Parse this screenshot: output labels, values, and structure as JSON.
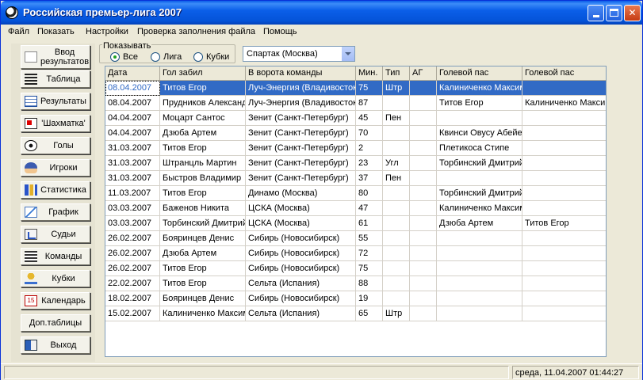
{
  "window": {
    "title": "Российская премьер-лига 2007",
    "min_label": "_",
    "close_label": "✕"
  },
  "menu": [
    "Файл",
    "Показать",
    "Настройки",
    "Проверка заполнения файла",
    "Помощь"
  ],
  "sidebar": [
    {
      "label": "Ввод результатов",
      "icon": "input-icon"
    },
    {
      "label": "Таблица",
      "icon": "list-icon"
    },
    {
      "label": "Результаты",
      "icon": "table-icon"
    },
    {
      "label": "'Шахматка'",
      "icon": "grid-icon"
    },
    {
      "label": "Голы",
      "icon": "ball-icon"
    },
    {
      "label": "Игроки",
      "icon": "player-icon"
    },
    {
      "label": "Статистика",
      "icon": "statistics-icon"
    },
    {
      "label": "График",
      "icon": "chart-icon"
    },
    {
      "label": "Судьи",
      "icon": "referee-icon"
    },
    {
      "label": "Команды",
      "icon": "teams-icon"
    },
    {
      "label": "Кубки",
      "icon": "cup-icon"
    },
    {
      "label": "Календарь",
      "icon": "calendar-icon"
    },
    {
      "label": "Доп.таблицы",
      "icon": ""
    },
    {
      "label": "Выход",
      "icon": "exit-icon"
    }
  ],
  "calendar_icon_text": "15",
  "filter": {
    "legend": "Показывать",
    "options": [
      "Все",
      "Лига",
      "Кубки"
    ],
    "selected": "Все",
    "team": "Спартак (Москва)"
  },
  "grid": {
    "columns": [
      "Дата",
      "Гол забил",
      "В ворота команды",
      "Мин.",
      "Тип",
      "АГ",
      "Голевой пас",
      "Голевой пас"
    ],
    "rows": [
      [
        "08.04.2007",
        "Титов Егор",
        "Луч-Энергия (Владивосток)",
        "75",
        "Штр",
        "",
        "Калиниченко Максим",
        ""
      ],
      [
        "08.04.2007",
        "Прудников Александр",
        "Луч-Энергия (Владивосток)",
        "87",
        "",
        "",
        "Титов Егор",
        "Калиниченко Максим"
      ],
      [
        "04.04.2007",
        "Моцарт Сантос",
        "Зенит (Санкт-Петербург)",
        "45",
        "Пен",
        "",
        "",
        ""
      ],
      [
        "04.04.2007",
        "Дзюба Артем",
        "Зенит (Санкт-Петербург)",
        "70",
        "",
        "",
        "Квинси Овусу Абейе",
        ""
      ],
      [
        "31.03.2007",
        "Титов Егор",
        "Зенит (Санкт-Петербург)",
        "2",
        "",
        "",
        "Плетикоса Стипе",
        ""
      ],
      [
        "31.03.2007",
        "Штранцль Мартин",
        "Зенит (Санкт-Петербург)",
        "23",
        "Угл",
        "",
        "Торбинский Дмитрий",
        ""
      ],
      [
        "31.03.2007",
        "Быстров Владимир",
        "Зенит (Санкт-Петербург)",
        "37",
        "Пен",
        "",
        "",
        ""
      ],
      [
        "11.03.2007",
        "Титов Егор",
        "Динамо (Москва)",
        "80",
        "",
        "",
        "Торбинский Дмитрий",
        ""
      ],
      [
        "03.03.2007",
        "Баженов Никита",
        "ЦСКА (Москва)",
        "47",
        "",
        "",
        "Калиниченко Максим",
        ""
      ],
      [
        "03.03.2007",
        "Торбинский Дмитрий",
        "ЦСКА (Москва)",
        "61",
        "",
        "",
        "Дзюба Артем",
        "Титов Егор"
      ],
      [
        "26.02.2007",
        "Бояринцев Денис",
        "Сибирь (Новосибирск)",
        "55",
        "",
        "",
        "",
        ""
      ],
      [
        "26.02.2007",
        "Дзюба Артем",
        "Сибирь (Новосибирск)",
        "72",
        "",
        "",
        "",
        ""
      ],
      [
        "26.02.2007",
        "Титов Егор",
        "Сибирь (Новосибирск)",
        "75",
        "",
        "",
        "",
        ""
      ],
      [
        "22.02.2007",
        "Титов Егор",
        "Сельта (Испания)",
        "88",
        "",
        "",
        "",
        ""
      ],
      [
        "18.02.2007",
        "Бояринцев Денис",
        "Сибирь (Новосибирск)",
        "19",
        "",
        "",
        "",
        ""
      ],
      [
        "15.02.2007",
        "Калиниченко Максим",
        "Сельта (Испания)",
        "65",
        "Штр",
        "",
        "",
        ""
      ]
    ],
    "selected_row": 0
  },
  "status": {
    "datetime": "среда, 11.04.2007 01:44:27"
  }
}
